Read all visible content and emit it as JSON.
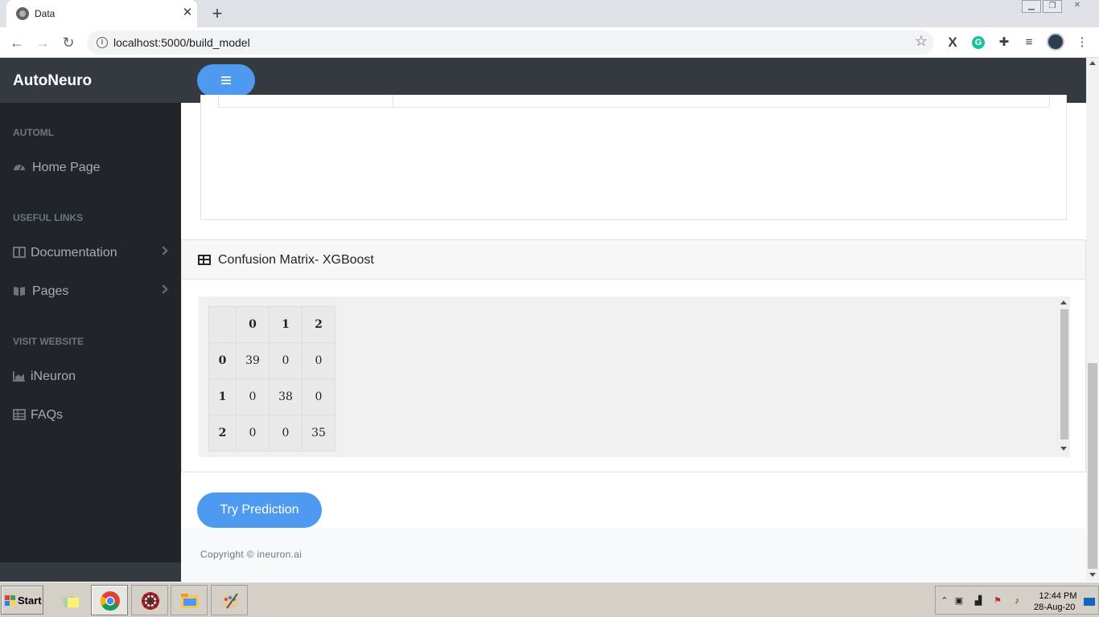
{
  "browser": {
    "tab_title": "Data",
    "tab_close": "✕",
    "new_tab": "+",
    "url": "localhost:5000/build_model",
    "icons": [
      "back-icon",
      "forward-icon",
      "reload-icon",
      "info-icon",
      "star-icon",
      "x-extension-icon",
      "grammarly-icon",
      "puzzle-icon",
      "media-icon",
      "avatar",
      "menu-icon"
    ]
  },
  "app": {
    "brand": "AutoNeuro",
    "sidebar": {
      "sections": [
        {
          "heading": "AUTOML",
          "items": [
            {
              "label": "Home Page",
              "icon": "dashboard-icon",
              "has_chevron": false
            }
          ]
        },
        {
          "heading": "USEFUL LINKS",
          "items": [
            {
              "label": "Documentation",
              "icon": "columns-icon",
              "has_chevron": true
            },
            {
              "label": "Pages",
              "icon": "book-icon",
              "has_chevron": true
            }
          ]
        },
        {
          "heading": "VISIT WEBSITE",
          "items": [
            {
              "label": "iNeuron",
              "icon": "chart-area-icon",
              "has_chevron": false
            },
            {
              "label": "FAQs",
              "icon": "table-icon",
              "has_chevron": false
            }
          ]
        }
      ]
    },
    "confusion_matrix": {
      "title": "Confusion Matrix- XGBoost",
      "columns": [
        "",
        "0",
        "1",
        "2"
      ],
      "rows": [
        {
          "label": "0",
          "values": [
            "39",
            "0",
            "0"
          ]
        },
        {
          "label": "1",
          "values": [
            "0",
            "38",
            "0"
          ]
        },
        {
          "label": "2",
          "values": [
            "0",
            "0",
            "35"
          ]
        }
      ]
    },
    "predict_button": "Try Prediction",
    "footer": "Copyright © ineuron.ai"
  },
  "taskbar": {
    "start": "Start",
    "time": "12:44 PM",
    "date": "28-Aug-20"
  },
  "colors": {
    "accent": "#4e9af1",
    "sidebar_bg": "#212529",
    "topbar_bg": "#343a40"
  }
}
